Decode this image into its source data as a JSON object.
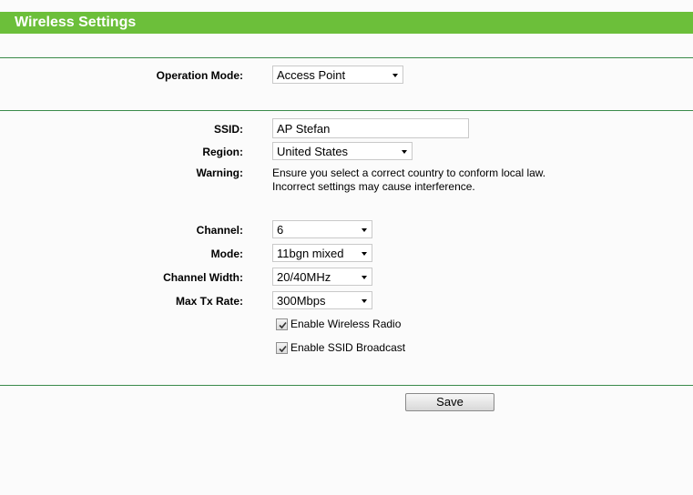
{
  "header": {
    "title": "Wireless Settings"
  },
  "operation_mode": {
    "label": "Operation Mode:",
    "value": "Access Point"
  },
  "ssid": {
    "label": "SSID:",
    "value": "AP Stefan"
  },
  "region": {
    "label": "Region:",
    "value": "United States"
  },
  "warning": {
    "label": "Warning:",
    "line1": "Ensure you select a correct country to conform local law.",
    "line2": "Incorrect settings may cause interference."
  },
  "channel": {
    "label": "Channel:",
    "value": "6"
  },
  "mode": {
    "label": "Mode:",
    "value": "11bgn mixed"
  },
  "channel_width": {
    "label": "Channel Width:",
    "value": "20/40MHz"
  },
  "max_tx_rate": {
    "label": "Max Tx Rate:",
    "value": "300Mbps"
  },
  "enable_wireless_radio": {
    "label": "Enable Wireless Radio",
    "checked": true
  },
  "enable_ssid_broadcast": {
    "label": "Enable SSID Broadcast",
    "checked": true
  },
  "save_button": {
    "label": "Save"
  },
  "colors": {
    "title_bar": "#6cbf3a",
    "divider": "#3a8a4a",
    "background": "#fbfbfb"
  }
}
